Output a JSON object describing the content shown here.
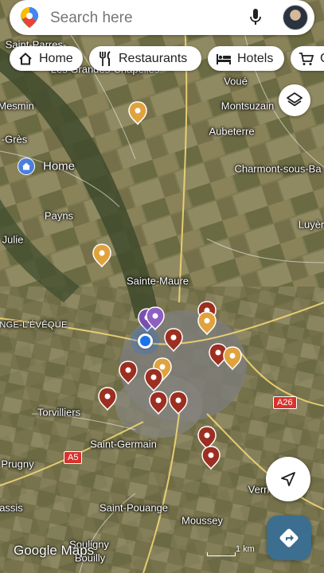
{
  "search": {
    "placeholder": "Search here"
  },
  "chips": [
    {
      "label": "Home",
      "icon": "home-icon"
    },
    {
      "label": "Restaurants",
      "icon": "fork-knife-icon"
    },
    {
      "label": "Hotels",
      "icon": "bed-icon"
    },
    {
      "label": "G",
      "icon": "cart-icon"
    }
  ],
  "map_labels": {
    "saint_parres": "Saint-Parres-",
    "grandes_chapelles": "Les Grandes-Chapelles",
    "voue": "Voué",
    "mesmin": "Mesmin",
    "montsuzain": "Montsuzain",
    "gres": "-Grès",
    "aubeterre": "Aubeterre",
    "home": "Home",
    "charmont": "Charmont-sous-Ba",
    "payns": "Payns",
    "luyere": "Luyèr",
    "julie": "Julie",
    "sainte_maure": "Sainte-Maure",
    "eveque": "NGE-L'ÉVÊQUE",
    "torvilliers": "Torvilliers",
    "a26": "A26",
    "saint_germain": "Saint-Germain",
    "a5": "A5",
    "prugny": "Prugny",
    "verri": "Verri",
    "assis": "assis",
    "saint_pouange": "Saint-Pouange",
    "moussey": "Moussey",
    "souligny": "Souligny",
    "bouilly": "Bouilly"
  },
  "attribution": {
    "logo": "Google Maps",
    "scale": "1 km"
  },
  "colors": {
    "pin_red": "#9c2f21",
    "pin_orange": "#e0a23c",
    "pin_purple": "#7b4fb0",
    "location_blue": "#1a73e8",
    "road": "#f2d675",
    "directions_button": "#3b6e8f"
  },
  "controls": {
    "layers": "layers-icon",
    "my_location": "navigation-arrow-icon",
    "directions": "directions-icon"
  }
}
